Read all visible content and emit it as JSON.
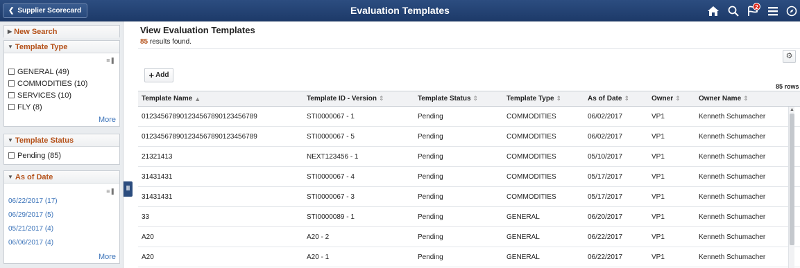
{
  "header": {
    "back_label": "Supplier Scorecard",
    "title": "Evaluation Templates",
    "notification_count": "2",
    "icons": [
      "home-icon",
      "search-icon",
      "notification-flag-icon",
      "menu-icon",
      "navbar-compass-icon"
    ]
  },
  "filters": {
    "new_search": "New Search",
    "template_type": {
      "title": "Template Type",
      "items": [
        "GENERAL (49)",
        "COMMODITIES (10)",
        "SERVICES (10)",
        "FLY (8)"
      ],
      "more": "More"
    },
    "template_status": {
      "title": "Template Status",
      "items": [
        "Pending (85)"
      ]
    },
    "as_of_date": {
      "title": "As of Date",
      "items": [
        "06/22/2017 (17)",
        "06/29/2017 (5)",
        "05/21/2017 (4)",
        "06/06/2017 (4)"
      ],
      "more": "More"
    }
  },
  "main": {
    "page_title": "View Evaluation Templates",
    "results_count": "85",
    "results_suffix": " results found.",
    "add_label": "Add",
    "rows_label": "85 rows",
    "columns": [
      "Template Name",
      "Template ID - Version",
      "Template Status",
      "Template Type",
      "As of Date",
      "Owner",
      "Owner Name"
    ],
    "rows": [
      [
        "012345678901234567890123456789",
        "STI0000067 - 1",
        "Pending",
        "COMMODITIES",
        "06/02/2017",
        "VP1",
        "Kenneth Schumacher"
      ],
      [
        "012345678901234567890123456789",
        "STI0000067 - 5",
        "Pending",
        "COMMODITIES",
        "06/02/2017",
        "VP1",
        "Kenneth Schumacher"
      ],
      [
        "21321413",
        "NEXT123456 - 1",
        "Pending",
        "COMMODITIES",
        "05/10/2017",
        "VP1",
        "Kenneth Schumacher"
      ],
      [
        "31431431",
        "STI0000067 - 4",
        "Pending",
        "COMMODITIES",
        "05/17/2017",
        "VP1",
        "Kenneth Schumacher"
      ],
      [
        "31431431",
        "STI0000067 - 3",
        "Pending",
        "COMMODITIES",
        "05/17/2017",
        "VP1",
        "Kenneth Schumacher"
      ],
      [
        "33",
        "STI0000089 - 1",
        "Pending",
        "GENERAL",
        "06/20/2017",
        "VP1",
        "Kenneth Schumacher"
      ],
      [
        "A20",
        "A20 - 2",
        "Pending",
        "GENERAL",
        "06/22/2017",
        "VP1",
        "Kenneth Schumacher"
      ],
      [
        "A20",
        "A20 - 1",
        "Pending",
        "GENERAL",
        "06/22/2017",
        "VP1",
        "Kenneth Schumacher"
      ]
    ]
  }
}
